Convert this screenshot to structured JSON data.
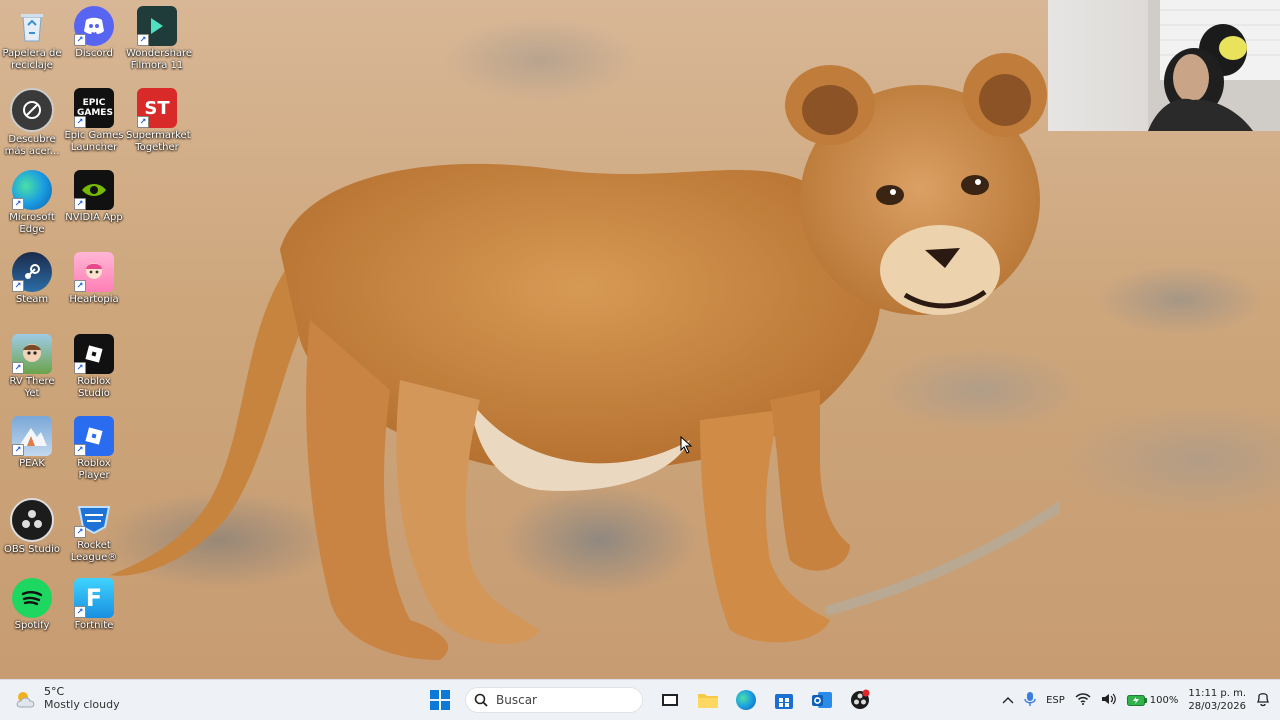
{
  "desktop": {
    "icons": [
      {
        "label": "Papelera de reciclaje",
        "icon": "recycle-bin-icon"
      },
      {
        "label": "Discord",
        "icon": "discord-icon"
      },
      {
        "label": "Wondershare Filmora 11",
        "icon": "filmora-icon"
      },
      {
        "label": "Descubre más acer...",
        "icon": "acer-icon"
      },
      {
        "label": "Epic Games Launcher",
        "icon": "epic-games-icon",
        "text": "EPIC GAMES"
      },
      {
        "label": "Supermarket Together",
        "icon": "supermarket-icon",
        "text": "ST"
      },
      {
        "label": "Microsoft Edge",
        "icon": "edge-icon"
      },
      {
        "label": "NVIDIA App",
        "icon": "nvidia-icon"
      },
      {
        "label": "Steam",
        "icon": "steam-icon"
      },
      {
        "label": "Heartopia",
        "icon": "heartopia-icon"
      },
      {
        "label": "RV There Yet",
        "icon": "rv-there-yet-icon"
      },
      {
        "label": "Roblox Studio",
        "icon": "roblox-studio-icon"
      },
      {
        "label": "PEAK",
        "icon": "peak-icon"
      },
      {
        "label": "Roblox Player",
        "icon": "roblox-player-icon"
      },
      {
        "label": "OBS Studio",
        "icon": "obs-icon"
      },
      {
        "label": "Rocket League®",
        "icon": "rocket-league-icon"
      },
      {
        "label": "Spotify",
        "icon": "spotify-icon"
      },
      {
        "label": "Fortnite",
        "icon": "fortnite-icon",
        "text": "F"
      }
    ]
  },
  "taskbar": {
    "weather": {
      "temp": "5°C",
      "desc": "Mostly cloudy",
      "icon": "cloudy-weather-icon"
    },
    "search_placeholder": "Buscar",
    "apps": [
      {
        "name": "task-view",
        "icon": "task-view-icon"
      },
      {
        "name": "file-explorer",
        "icon": "folder-icon"
      },
      {
        "name": "edge",
        "icon": "edge-icon"
      },
      {
        "name": "store",
        "icon": "store-icon"
      },
      {
        "name": "outlook",
        "icon": "outlook-icon"
      },
      {
        "name": "obs",
        "icon": "obs-recording-icon"
      }
    ],
    "tray": {
      "lang": "ESP",
      "battery": "100%",
      "time": "11:11 p. m.",
      "date": "28/03/2026"
    }
  },
  "colors": {
    "taskbar_bg": "#eef2f6",
    "windows_blue": "#0a7ad6",
    "discord": "#5865f2",
    "spotify": "#1ed760",
    "nvidia": "#76b900",
    "supermarket_red": "#d92a2a"
  }
}
